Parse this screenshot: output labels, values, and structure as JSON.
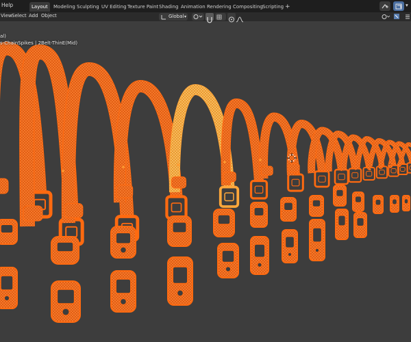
{
  "topbar": {
    "menu": [
      "Help"
    ],
    "workspace_tabs": [
      "Layout",
      "Modeling",
      "Sculpting",
      "UV Editing",
      "Texture Paint",
      "Shading",
      "Animation",
      "Rendering",
      "Compositing",
      "Scripting"
    ],
    "active_tab": "Layout",
    "add_tab": "+"
  },
  "header": {
    "menu": [
      "View",
      "Select",
      "Add",
      "Object"
    ],
    "orientation": "Global"
  },
  "viewport": {
    "info_line1": "al)",
    "info_line2": "s-ChainSpikes | 2Belt-ThinE(Mid)"
  },
  "colors": {
    "selected": "#ff6a10",
    "active": "#ffa73a",
    "background": "#3d3d3d"
  },
  "icons": [
    "cursor-icon",
    "snap-icon",
    "proportional-icon",
    "falloff-icon",
    "render-icon",
    "overlay-icon",
    "editor-icon"
  ]
}
